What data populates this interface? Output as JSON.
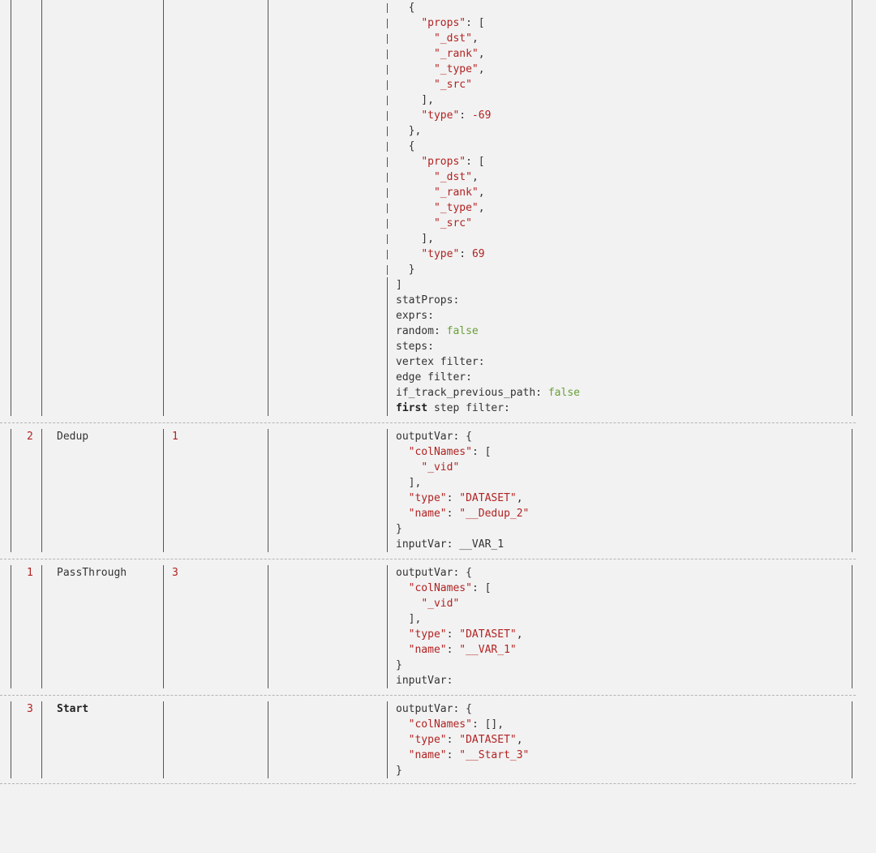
{
  "rows_continued": {
    "lines": [
      "{",
      "  \"props\": [",
      "    \"_dst\",",
      "    \"_rank\",",
      "    \"_type\",",
      "    \"_src\"",
      "  ],",
      "  \"type\": -69",
      "},",
      "{",
      "  \"props\": [",
      "    \"_dst\",",
      "    \"_rank\",",
      "    \"_type\",",
      "    \"_src\"",
      "  ],",
      "  \"type\": 69",
      "}",
      "]",
      "statProps:",
      "exprs:",
      "random: false",
      "steps:",
      "vertex filter:",
      "edge filter:",
      "if_track_previous_path: false",
      "first step filter:"
    ]
  },
  "rows": [
    {
      "id": "2",
      "name": "Dedup",
      "deps": "1",
      "lines": [
        "outputVar: {",
        "  \"colNames\": [",
        "    \"_vid\"",
        "  ],",
        "  \"type\": \"DATASET\",",
        "  \"name\": \"__Dedup_2\"",
        "}",
        "inputVar: __VAR_1"
      ]
    },
    {
      "id": "1",
      "name": "PassThrough",
      "deps": "3",
      "lines": [
        "outputVar: {",
        "  \"colNames\": [",
        "    \"_vid\"",
        "  ],",
        "  \"type\": \"DATASET\",",
        "  \"name\": \"__VAR_1\"",
        "}",
        "inputVar:"
      ]
    },
    {
      "id": "3",
      "name": "Start",
      "deps": "",
      "lines": [
        "outputVar: {",
        "  \"colNames\": [],",
        "  \"type\": \"DATASET\",",
        "  \"name\": \"__Start_3\"",
        "}"
      ]
    }
  ]
}
